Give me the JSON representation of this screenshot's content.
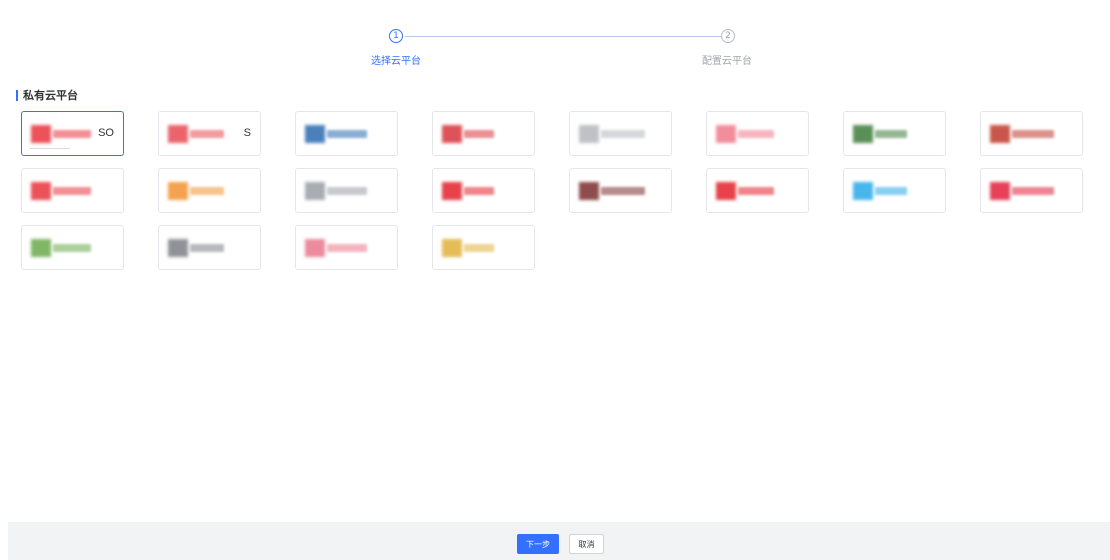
{
  "steps": [
    {
      "number": "1",
      "label": "选择云平台",
      "state": "active"
    },
    {
      "number": "2",
      "label": "配置云平台",
      "state": "inactive"
    }
  ],
  "section": {
    "title": "私有云平台"
  },
  "platforms": [
    {
      "name": "platform-1",
      "visible_text": "SO",
      "color": "#e8343d",
      "selected": true
    },
    {
      "name": "platform-2",
      "visible_text": "S",
      "color": "#e84a52",
      "selected": false
    },
    {
      "name": "platform-3",
      "visible_text": "",
      "color": "#2b6cb0",
      "selected": false
    },
    {
      "name": "platform-4",
      "visible_text": "",
      "color": "#d9343d",
      "selected": false
    },
    {
      "name": "platform-5",
      "visible_text": "",
      "color": "#b4b7bd",
      "selected": false
    },
    {
      "name": "platform-6",
      "visible_text": "",
      "color": "#f07a8a",
      "selected": false
    },
    {
      "name": "platform-7",
      "visible_text": "",
      "color": "#3e7d3a",
      "selected": false
    },
    {
      "name": "platform-8",
      "visible_text": "",
      "color": "#c0392b",
      "selected": false
    },
    {
      "name": "platform-9",
      "visible_text": "",
      "color": "#e8343d",
      "selected": false
    },
    {
      "name": "platform-10",
      "visible_text": "",
      "color": "#f39232",
      "selected": false
    },
    {
      "name": "platform-11",
      "visible_text": "",
      "color": "#9a9ea6",
      "selected": false
    },
    {
      "name": "platform-12",
      "visible_text": "",
      "color": "#e3202b",
      "selected": false
    },
    {
      "name": "platform-13",
      "visible_text": "",
      "color": "#7b2d2d",
      "selected": false
    },
    {
      "name": "platform-14",
      "visible_text": "",
      "color": "#e3202b",
      "selected": false
    },
    {
      "name": "platform-15",
      "visible_text": "",
      "color": "#29a9e8",
      "selected": false
    },
    {
      "name": "platform-16",
      "visible_text": "",
      "color": "#e3203c",
      "selected": false
    },
    {
      "name": "platform-17",
      "visible_text": "",
      "color": "#6aaa4a",
      "selected": false
    },
    {
      "name": "platform-18",
      "visible_text": "",
      "color": "#7d8087",
      "selected": false
    },
    {
      "name": "platform-19",
      "visible_text": "",
      "color": "#e9778c",
      "selected": false
    },
    {
      "name": "platform-20",
      "visible_text": "",
      "color": "#e0b23a",
      "selected": false
    }
  ],
  "footer": {
    "next_label": "下一步",
    "cancel_label": "取消"
  },
  "colors": {
    "accent": "#3370ff",
    "footer_bg": "#f2f3f5",
    "border": "#e4e6eb"
  }
}
